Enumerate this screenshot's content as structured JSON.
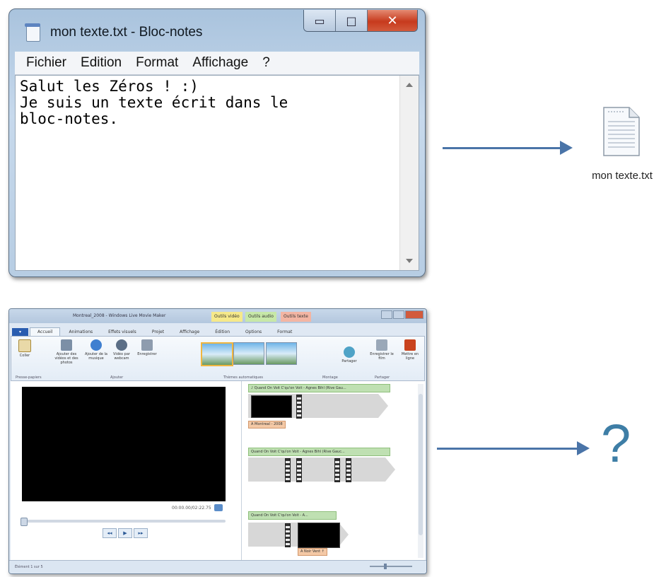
{
  "notepad": {
    "title": "mon texte.txt - Bloc-notes",
    "controls": {
      "minimize": "▭",
      "maximize": "□",
      "close": "✕"
    },
    "menu": [
      "Fichier",
      "Edition",
      "Format",
      "Affichage",
      "?"
    ],
    "content": "Salut les Zéros ! :)\nJe suis un texte écrit dans le\nbloc-notes."
  },
  "file": {
    "label": "mon texte.txt"
  },
  "unknown": {
    "symbol": "?"
  },
  "moviemaker": {
    "title": "Montreal_2008 - Windows Live Movie Maker",
    "context_tabs": [
      "Outils vidéo",
      "Outils audio",
      "Outils texte"
    ],
    "tabs": [
      "Accueil",
      "Animations",
      "Effets visuels",
      "Projet",
      "Affichage",
      "Édition",
      "Options",
      "Format"
    ],
    "ribbon": {
      "paste": "Coller",
      "add_videos": "Ajouter des vidéos et des photos",
      "add_music": "Ajouter de la musique",
      "snapshot": "Vidéo par webcam",
      "narration": "Enregistrer",
      "share": "Partager",
      "save": "Enregistrer le film",
      "signin": "Mettre en ligne",
      "groups": [
        "Presse-papiers",
        "Ajouter",
        "Thèmes automatiques",
        "Montage",
        "Partager"
      ]
    },
    "time": "00:00.00/02:22.75",
    "playback": [
      "◂◂",
      "▶",
      "▸▸"
    ],
    "captions": [
      "♪ Quand On Voit C'qu'on Voit - Agnes Bihl (Rive Gau...",
      "Quand On Voit C'qu'on Voit - Agnes Bihl (Rive Gauc...",
      "Quand On Voit C'qu'on Voit - A..."
    ],
    "clip_labels": [
      "A Montreal - 2008",
      "A Noir Vent ↑"
    ],
    "status": "Élément 1 sur 5"
  },
  "colors": {
    "arrow": "#4a74a8",
    "question_mark": "#3e7ea6"
  }
}
